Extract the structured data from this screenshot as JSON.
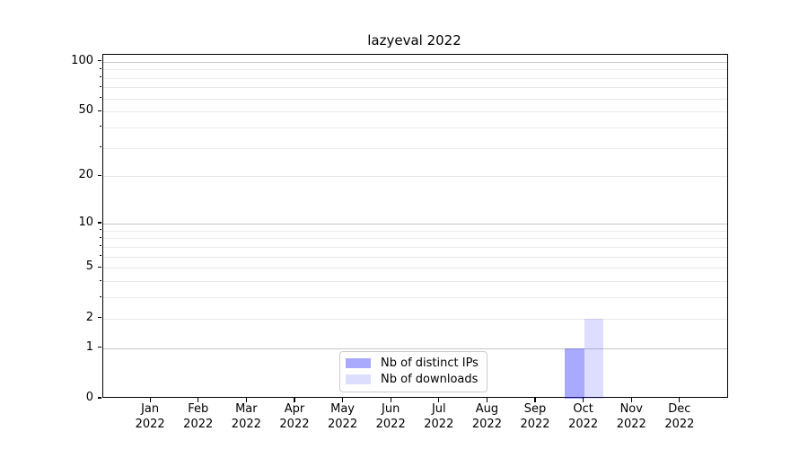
{
  "chart_data": {
    "type": "bar",
    "title": "lazyeval 2022",
    "year_label": "2022",
    "categories": [
      "Jan",
      "Feb",
      "Mar",
      "Apr",
      "May",
      "Jun",
      "Jul",
      "Aug",
      "Sep",
      "Oct",
      "Nov",
      "Dec"
    ],
    "series": [
      {
        "name": "Nb of distinct IPs",
        "color": "rgba(41,41,250,0.40)",
        "values": [
          0,
          0,
          0,
          0,
          0,
          0,
          0,
          0,
          0,
          1,
          0,
          0
        ]
      },
      {
        "name": "Nb of downloads",
        "color": "rgba(41,41,250,0.16)",
        "values": [
          0,
          0,
          0,
          0,
          0,
          0,
          0,
          0,
          0,
          2,
          0,
          0
        ]
      }
    ],
    "yscale": "log1p",
    "ylim": [
      0,
      110
    ],
    "yticks": [
      0,
      1,
      2,
      5,
      10,
      20,
      50,
      100
    ],
    "yticks_decade": [
      1,
      10,
      100
    ],
    "yticks_minor": [
      3,
      4,
      6,
      7,
      8,
      9,
      30,
      40,
      60,
      70,
      80,
      90
    ],
    "grid": true,
    "legend_position": "lower center",
    "colors": {
      "grid_major": "#c6c6c6",
      "grid_minor": "#eaeaea",
      "spine": "#000000",
      "text": "#000000"
    }
  }
}
